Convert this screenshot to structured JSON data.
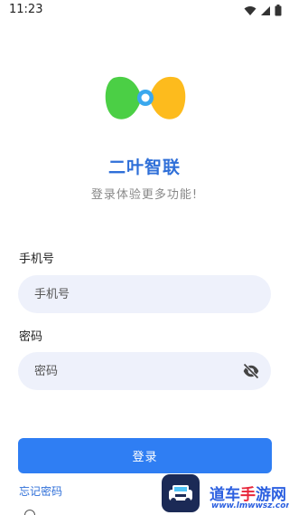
{
  "status_bar": {
    "time": "11:23",
    "icons": [
      "wifi-icon",
      "signal-icon",
      "battery-icon"
    ]
  },
  "app": {
    "name": "二叶智联",
    "tagline": "登录体验更多功能!",
    "brand_color": "#2f6fd8"
  },
  "form": {
    "phone_label": "手机号",
    "phone_placeholder": "手机号",
    "password_label": "密码",
    "password_placeholder": "密码",
    "login_button": "登录",
    "forgot_password": "忘记密码",
    "button_color": "#2f7ef3",
    "input_bg": "#eef1fb"
  },
  "watermark": {
    "title_a": "道车",
    "title_b": "手",
    "title_c": "游网",
    "url": "www.lmwwsz.com"
  }
}
